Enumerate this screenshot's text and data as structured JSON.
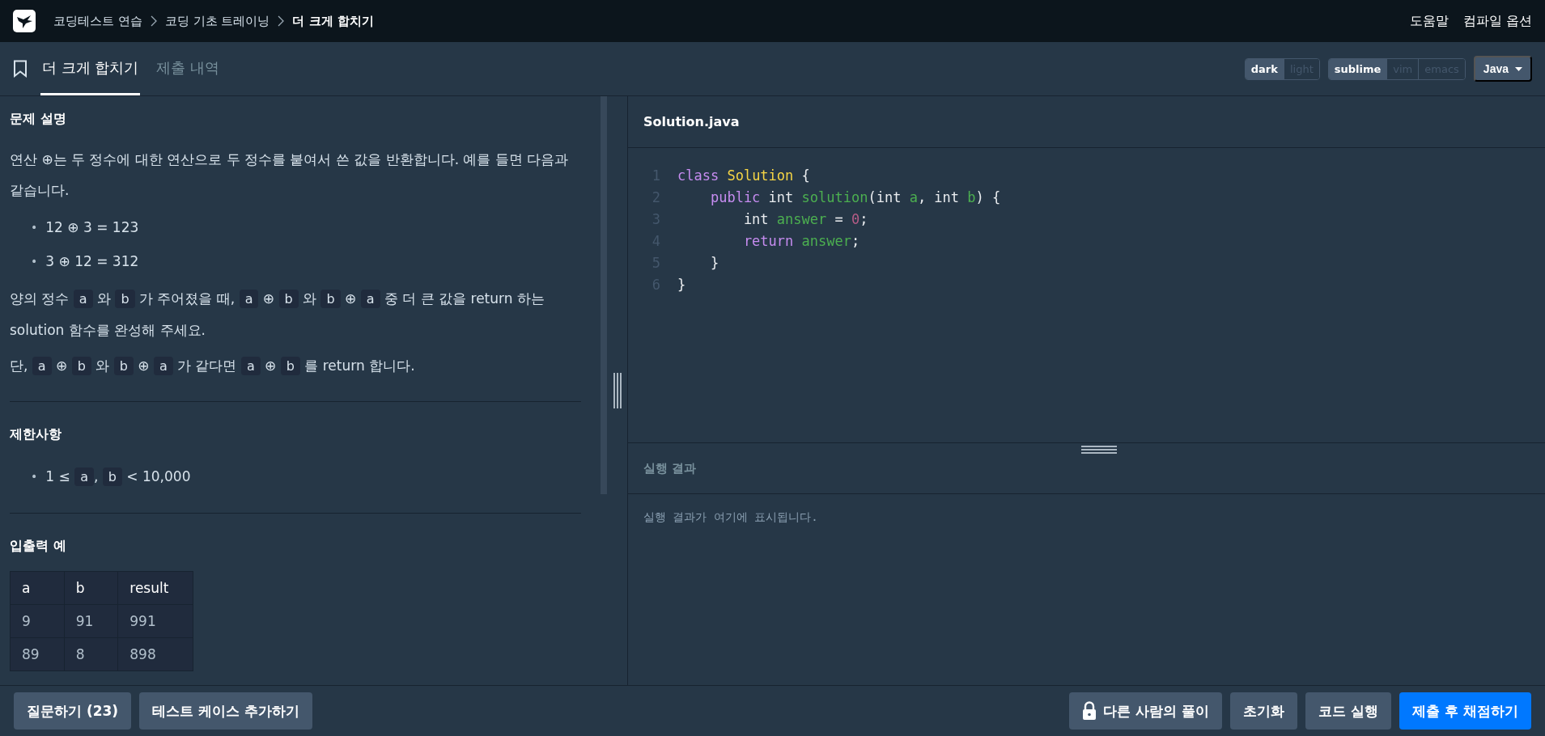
{
  "breadcrumbs": [
    {
      "label": "코딩테스트 연습",
      "current": false
    },
    {
      "label": "코딩 기초 트레이닝",
      "current": false
    },
    {
      "label": "더 크게 합치기",
      "current": true
    }
  ],
  "top_links": [
    "도움말",
    "컴파일 옵션"
  ],
  "tabs": [
    {
      "label": "더 크게 합치기",
      "selected": true
    },
    {
      "label": "제출 내역",
      "selected": false
    }
  ],
  "theme_toggle": [
    {
      "label": "dark",
      "selected": true
    },
    {
      "label": "light",
      "selected": false
    }
  ],
  "keymap_toggle": [
    {
      "label": "sublime",
      "selected": true
    },
    {
      "label": "vim",
      "selected": false
    },
    {
      "label": "emacs",
      "selected": false
    }
  ],
  "language": "Java",
  "sections": [
    {
      "title": "문제 설명",
      "blocks": [
        {
          "kind": "paragraph",
          "segments": [
            {
              "kind": "text",
              "text": "연산 ⊕는 두 정수에 대한 연산으로 두 정수를 붙여서 쓴 값을 반환합니다. 예를 들면 다음과 같습니다."
            }
          ]
        },
        {
          "kind": "bullets",
          "items": [
            {
              "marker": "•",
              "segments": [
                {
                  "kind": "text",
                  "text": "12 ⊕ 3 = 123"
                }
              ]
            },
            {
              "marker": "•",
              "segments": [
                {
                  "kind": "text",
                  "text": "3 ⊕ 12 = 312"
                }
              ]
            }
          ]
        },
        {
          "kind": "paragraph",
          "segments": [
            {
              "kind": "text",
              "text": "양의 정수 "
            },
            {
              "kind": "code",
              "text": "a"
            },
            {
              "kind": "text",
              "text": " 와 "
            },
            {
              "kind": "code",
              "text": "b"
            },
            {
              "kind": "text",
              "text": " 가 주어졌을 때, "
            },
            {
              "kind": "code",
              "text": "a"
            },
            {
              "kind": "text",
              "text": " ⊕ "
            },
            {
              "kind": "code",
              "text": "b"
            },
            {
              "kind": "text",
              "text": " 와 "
            },
            {
              "kind": "code",
              "text": "b"
            },
            {
              "kind": "text",
              "text": " ⊕ "
            },
            {
              "kind": "code",
              "text": "a"
            },
            {
              "kind": "text",
              "text": " 중 더 큰 값을 return 하는 solution 함수를 완성해 주세요."
            }
          ]
        },
        {
          "kind": "paragraph",
          "segments": [
            {
              "kind": "text",
              "text": "단, "
            },
            {
              "kind": "code",
              "text": "a"
            },
            {
              "kind": "text",
              "text": " ⊕ "
            },
            {
              "kind": "code",
              "text": "b"
            },
            {
              "kind": "text",
              "text": " 와 "
            },
            {
              "kind": "code",
              "text": "b"
            },
            {
              "kind": "text",
              "text": " ⊕ "
            },
            {
              "kind": "code",
              "text": "a"
            },
            {
              "kind": "text",
              "text": " 가 같다면 "
            },
            {
              "kind": "code",
              "text": "a"
            },
            {
              "kind": "text",
              "text": " ⊕ "
            },
            {
              "kind": "code",
              "text": "b"
            },
            {
              "kind": "text",
              "text": " 를 return 합니다."
            }
          ]
        }
      ]
    },
    {
      "title": "제한사항",
      "blocks": [
        {
          "kind": "bullets",
          "items": [
            {
              "marker": "•",
              "segments": [
                {
                  "kind": "text",
                  "text": "1 ≤ "
                },
                {
                  "kind": "code",
                  "text": "a"
                },
                {
                  "kind": "text",
                  "text": ", "
                },
                {
                  "kind": "code",
                  "text": "b"
                },
                {
                  "kind": "text",
                  "text": " < 10,000"
                }
              ]
            }
          ]
        }
      ]
    },
    {
      "title": "입출력 예",
      "blocks": [
        {
          "kind": "table",
          "columns": [
            "a",
            "b",
            "result"
          ],
          "rows": [
            [
              "9",
              "91",
              "991"
            ],
            [
              "89",
              "8",
              "898"
            ]
          ]
        }
      ]
    }
  ],
  "editor": {
    "filename": "Solution.java",
    "lines": [
      {
        "number": "1",
        "tokens": [
          {
            "kind": "keyword",
            "text": "class"
          },
          {
            "kind": "class",
            "text": " Solution"
          },
          {
            "kind": "plain",
            "text": " {"
          }
        ]
      },
      {
        "number": "2",
        "tokens": [
          {
            "kind": "keyword",
            "text": "    public"
          },
          {
            "kind": "plain",
            "text": " int "
          },
          {
            "kind": "name",
            "text": "solution"
          },
          {
            "kind": "plain",
            "text": "(int "
          },
          {
            "kind": "name",
            "text": "a"
          },
          {
            "kind": "plain",
            "text": ", int "
          },
          {
            "kind": "name",
            "text": "b"
          },
          {
            "kind": "plain",
            "text": ") {"
          }
        ]
      },
      {
        "number": "3",
        "tokens": [
          {
            "kind": "plain",
            "text": "        int "
          },
          {
            "kind": "name",
            "text": "answer"
          },
          {
            "kind": "plain",
            "text": " = "
          },
          {
            "kind": "number",
            "text": "0"
          },
          {
            "kind": "plain",
            "text": ";"
          }
        ]
      },
      {
        "number": "4",
        "tokens": [
          {
            "kind": "keyword",
            "text": "        return"
          },
          {
            "kind": "name",
            "text": " answer"
          },
          {
            "kind": "plain",
            "text": ";"
          }
        ]
      },
      {
        "number": "5",
        "tokens": [
          {
            "kind": "plain",
            "text": "    }"
          }
        ]
      },
      {
        "number": "6",
        "tokens": [
          {
            "kind": "plain",
            "text": "}"
          }
        ]
      }
    ]
  },
  "result": {
    "title": "실행 결과",
    "message": "실행 결과가 여기에 표시됩니다."
  },
  "left_buttons": [
    "질문하기 (23)",
    "테스트 케이스 추가하기"
  ],
  "right_buttons": [
    {
      "label": "다른 사람의 풀이",
      "kind": "locked"
    },
    {
      "label": "초기화",
      "kind": "plain"
    },
    {
      "label": "코드 실행",
      "kind": "plain"
    },
    {
      "label": "제출 후 채점하기",
      "kind": "primary"
    }
  ]
}
